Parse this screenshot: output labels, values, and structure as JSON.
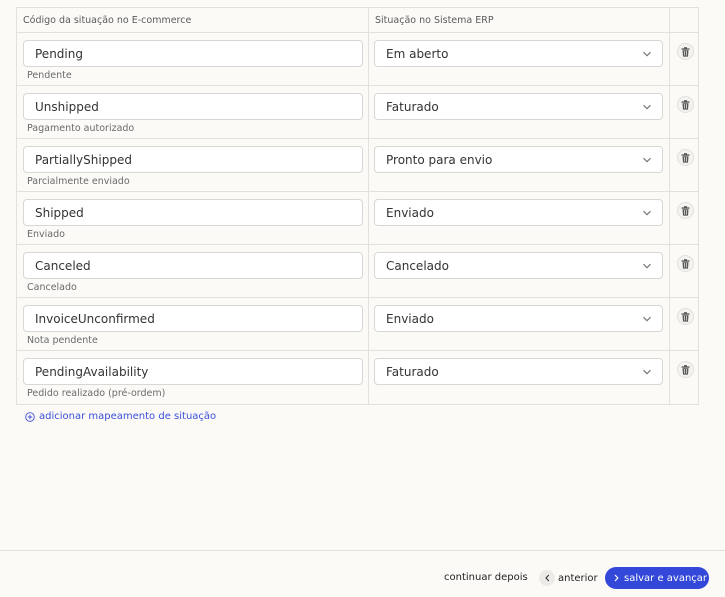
{
  "table": {
    "col1_header": "Código da situação no E-commerce",
    "col2_header": "Situação no Sistema ERP",
    "rows": [
      {
        "code": "Pending",
        "desc": "Pendente",
        "erp": "Em aberto"
      },
      {
        "code": "Unshipped",
        "desc": "Pagamento autorizado",
        "erp": "Faturado"
      },
      {
        "code": "PartiallyShipped",
        "desc": "Parcialmente enviado",
        "erp": "Pronto para envio"
      },
      {
        "code": "Shipped",
        "desc": "Enviado",
        "erp": "Enviado"
      },
      {
        "code": "Canceled",
        "desc": "Cancelado",
        "erp": "Cancelado"
      },
      {
        "code": "InvoiceUnconfirmed",
        "desc": "Nota pendente",
        "erp": "Enviado"
      },
      {
        "code": "PendingAvailability",
        "desc": "Pedido realizado (pré-ordem)",
        "erp": "Faturado"
      }
    ]
  },
  "add_mapping_label": "adicionar mapeamento de situação",
  "footer": {
    "later_label": "continuar depois",
    "prev_label": "anterior",
    "save_label": "salvar e avançar"
  },
  "colors": {
    "accent": "#3347d9",
    "link": "#3b4fd8"
  }
}
